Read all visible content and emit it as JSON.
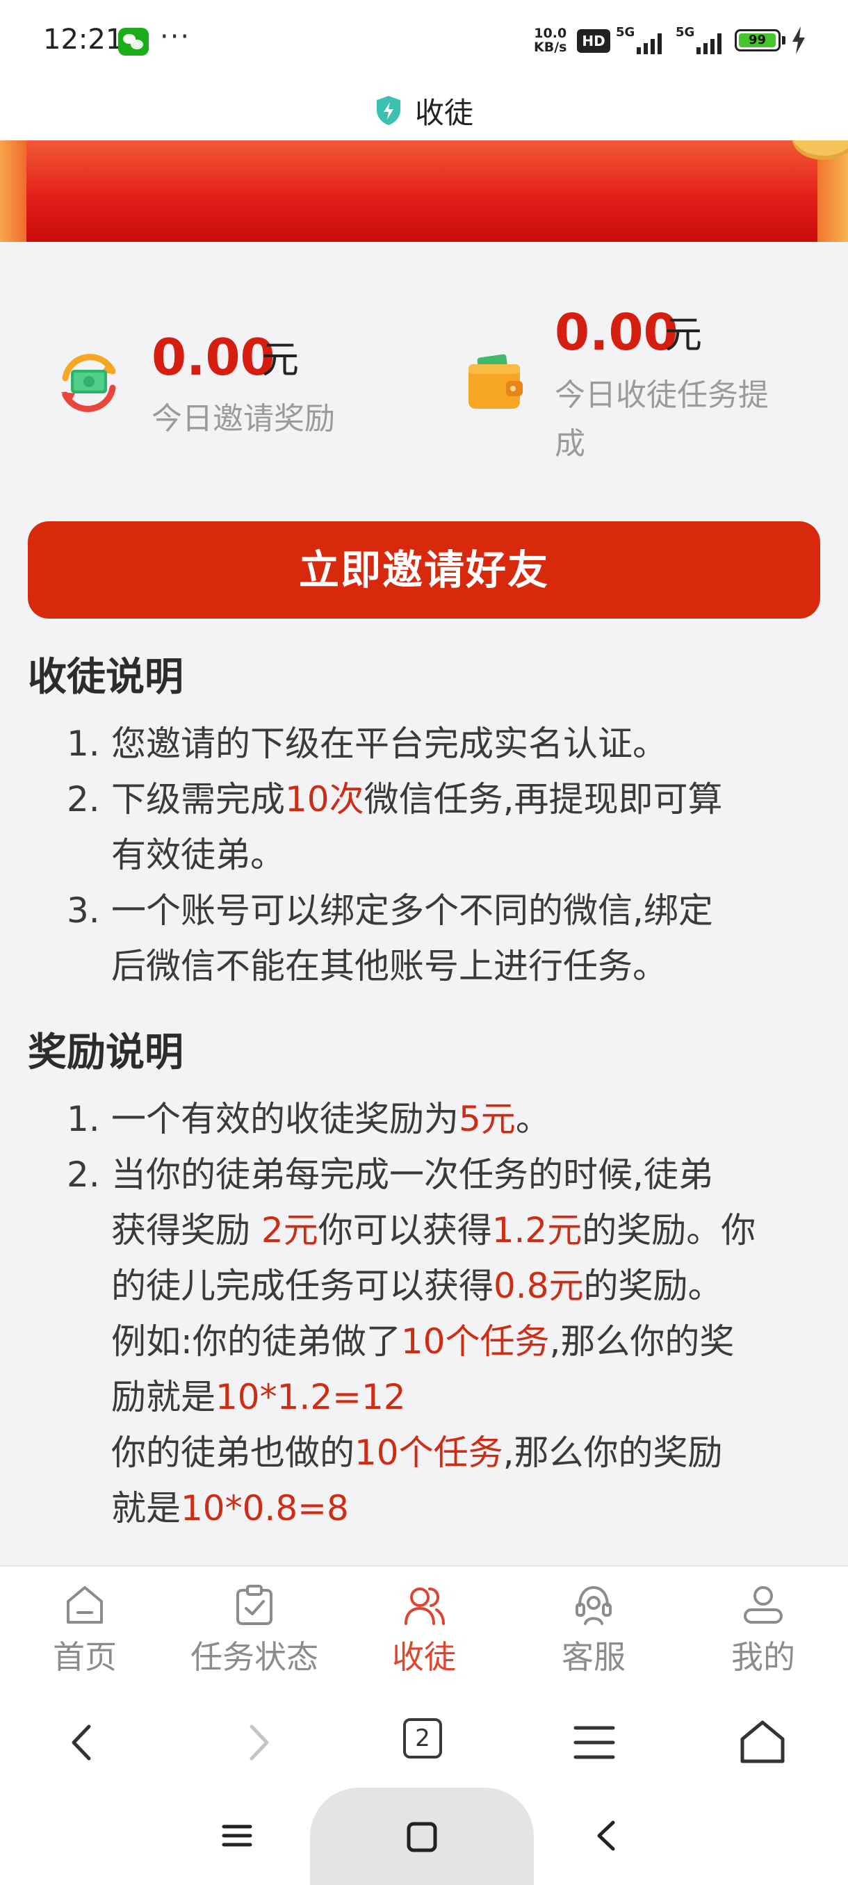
{
  "status_bar": {
    "time": "12:21",
    "dots": "···",
    "net_speed_value": "10.0",
    "net_speed_unit": "KB/s",
    "hd": "HD",
    "sim1": "5G",
    "sim2": "5G",
    "battery": "99"
  },
  "header": {
    "title": "收徒"
  },
  "stats": {
    "invite_reward": {
      "amount": "0.00",
      "unit": "元",
      "label": "今日邀请奖励"
    },
    "task_commission": {
      "amount": "0.00",
      "unit": "元",
      "label_line1": "今日收徒任务提",
      "label_line2": "成"
    }
  },
  "invite_button": "立即邀请好友",
  "apprentice_rules": {
    "title": "收徒说明",
    "items": [
      {
        "num": "1.",
        "line1": "您邀请的下级在平台完成实名认证。"
      },
      {
        "num": "2.",
        "line1_a": "下级需完成",
        "line1_hl": "10次",
        "line1_b": "微信任务,再提现即可算",
        "line2": "有效徒弟。"
      },
      {
        "num": "3.",
        "line1": "一个账号可以绑定多个不同的微信,绑定",
        "line2": "后微信不能在其他账号上进行任务。"
      }
    ]
  },
  "reward_rules": {
    "title": "奖励说明",
    "item1": {
      "num": "1.",
      "a": "一个有效的收徒奖励为",
      "hl": "5元",
      "b": "。"
    },
    "item2": {
      "num": "2.",
      "l1": "当你的徒弟每完成一次任务的时候,徒弟",
      "l2_a": "获得奖励 ",
      "l2_hl1": "2元",
      "l2_b": "你可以获得",
      "l2_hl2": "1.2元",
      "l2_c": "的奖励。你",
      "l3_a": "的徒儿完成任务可以获得",
      "l3_hl": "0.8元",
      "l3_b": "的奖励。",
      "l4_a": "例如:你的徒弟做了",
      "l4_hl": "10个任务",
      "l4_b": ",那么你的奖",
      "l5_a": "励就是",
      "l5_hl": "10*1.2=12",
      "l6_a": "你的徒弟也做的",
      "l6_hl": "10个任务",
      "l6_b": ",那么你的奖励",
      "l7_a": "就是",
      "l7_hl": "10*0.8=8"
    }
  },
  "bottom_nav": [
    {
      "label": "首页",
      "icon": "home-icon",
      "active": false
    },
    {
      "label": "任务状态",
      "icon": "clipboard-check-icon",
      "active": false
    },
    {
      "label": "收徒",
      "icon": "users-icon",
      "active": true
    },
    {
      "label": "客服",
      "icon": "headset-icon",
      "active": false
    },
    {
      "label": "我的",
      "icon": "user-icon",
      "active": false
    }
  ],
  "browser_bar": {
    "tab_count": "2"
  },
  "colors": {
    "accent_red": "#d8290c",
    "highlight_red": "#cf2d13",
    "nav_active": "#e0442e",
    "nav_inactive": "#8c8c8c"
  }
}
